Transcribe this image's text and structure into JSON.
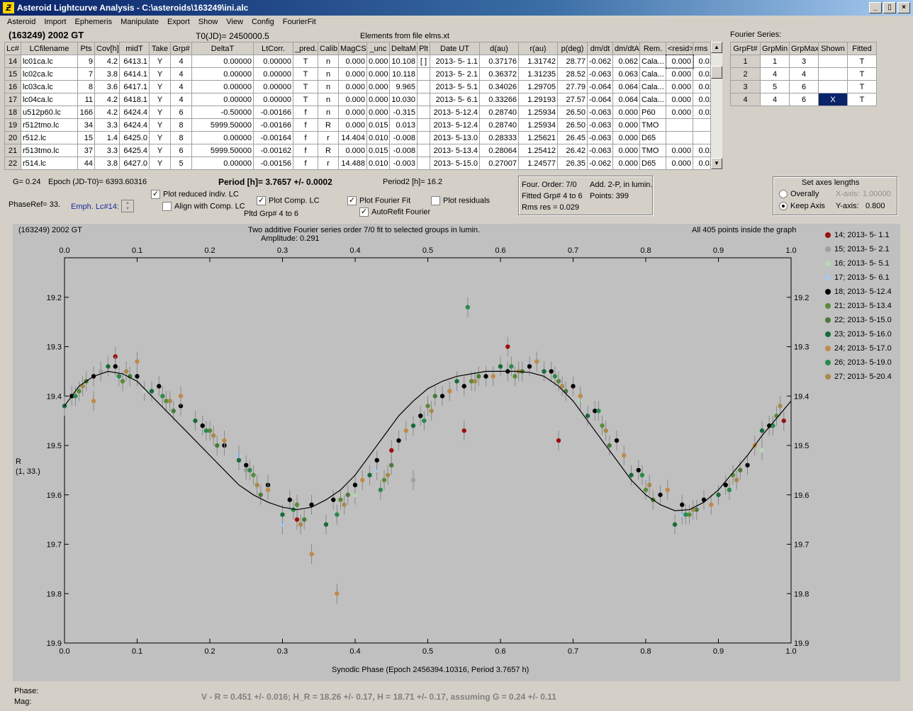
{
  "window": {
    "title": "Asteroid Lightcurve Analysis - C:\\asteroids\\163249\\ini.alc",
    "icon_letter": "Ƶ"
  },
  "window_buttons": [
    "_",
    "▯",
    "×"
  ],
  "menu": [
    "Asteroid",
    "Import",
    "Ephemeris",
    "Manipulate",
    "Export",
    "Show",
    "View",
    "Config",
    "FourierFit"
  ],
  "header": {
    "asteroid": "(163249) 2002 GT",
    "t0": "T0(JD)= 2450000.5",
    "elements": "Elements from file elms.xt",
    "fourier_label": "Fourier Series:"
  },
  "lc_table": {
    "columns": [
      "Lc#",
      "LCfilename",
      "Pts",
      "Cov[h]",
      "midT",
      "Take",
      "Grp#",
      "DeltaT",
      "LtCorr.",
      "_pred.",
      "Calib.",
      "MagCS",
      "_unc",
      "DeltaM",
      "Plt",
      "Date UT",
      "d(au)",
      "r(au)",
      "p(deg)",
      "dm/dt",
      "dm/dtA",
      "Rem.",
      "<resid>",
      "rms res"
    ],
    "rows": [
      [
        "14",
        "lc01ca.lc",
        "9",
        "4.2",
        "6413.1",
        "Y",
        "4",
        "0.00000",
        "0.00000",
        "T",
        "n",
        "0.000",
        "0.000",
        "10.108",
        "[ ]",
        "2013- 5- 1.1",
        "0.37176",
        "1.31742",
        "28.77",
        "-0.062",
        "0.062",
        "Cala...",
        "0.000",
        "0.036"
      ],
      [
        "15",
        "lc02ca.lc",
        "7",
        "3.8",
        "6414.1",
        "Y",
        "4",
        "0.00000",
        "0.00000",
        "T",
        "n",
        "0.000",
        "0.000",
        "10.118",
        "",
        "2013- 5- 2.1",
        "0.36372",
        "1.31235",
        "28.52",
        "-0.063",
        "0.063",
        "Cala...",
        "0.000",
        "0.028"
      ],
      [
        "16",
        "lc03ca.lc",
        "8",
        "3.6",
        "6417.1",
        "Y",
        "4",
        "0.00000",
        "0.00000",
        "T",
        "n",
        "0.000",
        "0.000",
        "9.965",
        "",
        "2013- 5- 5.1",
        "0.34026",
        "1.29705",
        "27.79",
        "-0.064",
        "0.064",
        "Cala...",
        "0.000",
        "0.028"
      ],
      [
        "17",
        "lc04ca.lc",
        "11",
        "4.2",
        "6418.1",
        "Y",
        "4",
        "0.00000",
        "0.00000",
        "T",
        "n",
        "0.000",
        "0.000",
        "10.030",
        "",
        "2013- 5- 6.1",
        "0.33266",
        "1.29193",
        "27.57",
        "-0.064",
        "0.064",
        "Cala...",
        "0.000",
        "0.020"
      ],
      [
        "18",
        "u512p60.lc",
        "166",
        "4.2",
        "6424.4",
        "Y",
        "6",
        "-0.50000",
        "-0.00166",
        "f",
        "n",
        "0.000",
        "0.000",
        "-0.315",
        "",
        "2013- 5-12.4",
        "0.28740",
        "1.25934",
        "26.50",
        "-0.063",
        "0.000",
        "P60",
        "0.000",
        "0.023"
      ],
      [
        "19",
        "r512tmo.lc",
        "34",
        "3.3",
        "6424.4",
        "Y",
        "8",
        "5999.50000",
        "-0.00166",
        "f",
        "R",
        "0.000",
        "0.015",
        "0.013",
        "",
        "2013- 5-12.4",
        "0.28740",
        "1.25934",
        "26.50",
        "-0.063",
        "0.000",
        "TMO",
        "",
        ""
      ],
      [
        "20",
        "r512.lc",
        "15",
        "1.4",
        "6425.0",
        "Y",
        "8",
        "0.00000",
        "-0.00164",
        "f",
        "r",
        "14.404",
        "0.010",
        "-0.008",
        "",
        "2013- 5-13.0",
        "0.28333",
        "1.25621",
        "26.45",
        "-0.063",
        "0.000",
        "D65",
        "",
        ""
      ],
      [
        "21",
        "r513tmo.lc",
        "37",
        "3.3",
        "6425.4",
        "Y",
        "6",
        "5999.50000",
        "-0.00162",
        "f",
        "R",
        "0.000",
        "0.015",
        "-0.008",
        "",
        "2013- 5-13.4",
        "0.28064",
        "1.25412",
        "26.42",
        "-0.063",
        "0.000",
        "TMO",
        "0.000",
        "0.029"
      ],
      [
        "22",
        "r514.lc",
        "44",
        "3.8",
        "6427.0",
        "Y",
        "5",
        "0.00000",
        "-0.00156",
        "f",
        "r",
        "14.488",
        "0.010",
        "-0.003",
        "",
        "2013- 5-15.0",
        "0.27007",
        "1.24577",
        "26.35",
        "-0.062",
        "0.000",
        "D65",
        "0.000",
        "0.033"
      ]
    ]
  },
  "fourier_table": {
    "columns": [
      "GrpFt#",
      "GrpMin",
      "GrpMax",
      "Shown",
      "Fitted"
    ],
    "rows": [
      [
        "1",
        "1",
        "3",
        "",
        "T"
      ],
      [
        "2",
        "4",
        "4",
        "",
        "T"
      ],
      [
        "3",
        "5",
        "6",
        "",
        "T"
      ],
      [
        "4",
        "4",
        "6",
        "X",
        "T"
      ]
    ]
  },
  "info": {
    "g": "G= 0.24",
    "epoch": "Epoch (JD-T0)= 6393.60316",
    "period": "Period [h]= 3.7657 +/- 0.0002",
    "period2": "Period2 [h]= 16.2",
    "phaseref": "PhaseRef= 33.",
    "emph": "Emph. Lc#14:",
    "four_order": "Four. Order:  7/0",
    "add": "Add. 2-P, in lumin.",
    "fitted": "Fitted Grp# 4 to 6",
    "points": "Points: 399",
    "rms": "Rms res     = 0.029"
  },
  "checkboxes": {
    "plot_reduced": {
      "label": "Plot reduced indiv. LC",
      "checked": true
    },
    "align": {
      "label": "Align with Comp. LC",
      "checked": false
    },
    "plot_comp": {
      "label": "Plot Comp. LC",
      "checked": true
    },
    "plot_fourier": {
      "label": "Plot Fourier Fit",
      "checked": true
    },
    "plot_residuals": {
      "label": "Plot residuals",
      "checked": false
    },
    "autorefit": {
      "label": "AutoRefit Fourier",
      "checked": true
    }
  },
  "pltd_grp": "Pltd Grp#  4   to    6",
  "axes_box": {
    "title": "Set axes lengths",
    "overally": "Overally",
    "keep_axis": "Keep Axis",
    "xaxis_label": "X-axis:",
    "xaxis_value": "1.00000",
    "yaxis_label": "Y-axis:",
    "yaxis_value": "0.800",
    "selected": "keep_axis"
  },
  "graph": {
    "left_title": "(163249) 2002 GT",
    "center_title": "Two additive Fourier series order 7/0 fit to selected groups in lumin.",
    "amplitude": "Amplitude: 0.291",
    "right_title": "All 405 points inside the graph",
    "ylabel1": "R",
    "ylabel2": "(1, 33.)",
    "xlabel": "Synodic Phase (Epoch 2456394.10316, Period 3.7657 h)"
  },
  "chart_data": {
    "type": "scatter",
    "x_ticks": [
      "0.0",
      "0.1",
      "0.2",
      "0.3",
      "0.4",
      "0.5",
      "0.6",
      "0.7",
      "0.8",
      "0.9",
      "1.0"
    ],
    "y_ticks": [
      "19.2",
      "19.3",
      "19.4",
      "19.5",
      "19.6",
      "19.7",
      "19.8",
      "19.9"
    ],
    "xlim": [
      0,
      1
    ],
    "ylim": [
      19.9,
      19.12
    ],
    "y_inverted": true,
    "fit_curve": {
      "x": [
        0.0,
        0.02,
        0.04,
        0.06,
        0.08,
        0.1,
        0.12,
        0.14,
        0.16,
        0.18,
        0.2,
        0.22,
        0.24,
        0.26,
        0.28,
        0.3,
        0.32,
        0.34,
        0.36,
        0.38,
        0.4,
        0.42,
        0.44,
        0.46,
        0.48,
        0.5,
        0.52,
        0.54,
        0.56,
        0.58,
        0.6,
        0.62,
        0.64,
        0.66,
        0.68,
        0.7,
        0.72,
        0.74,
        0.76,
        0.78,
        0.8,
        0.82,
        0.84,
        0.86,
        0.88,
        0.9,
        0.92,
        0.94,
        0.96,
        0.98,
        1.0
      ],
      "y": [
        19.42,
        19.38,
        19.36,
        19.35,
        19.355,
        19.37,
        19.4,
        19.43,
        19.46,
        19.49,
        19.52,
        19.55,
        19.58,
        19.6,
        19.615,
        19.625,
        19.63,
        19.625,
        19.61,
        19.59,
        19.56,
        19.52,
        19.48,
        19.44,
        19.41,
        19.385,
        19.37,
        19.36,
        19.355,
        19.35,
        19.35,
        19.35,
        19.352,
        19.36,
        19.38,
        19.41,
        19.45,
        19.49,
        19.53,
        19.57,
        19.6,
        19.62,
        19.632,
        19.63,
        19.615,
        19.59,
        19.555,
        19.52,
        19.48,
        19.445,
        19.41
      ]
    },
    "series": [
      {
        "name": "14; 2013- 5- 1.1",
        "color": "#9b1010",
        "x": [
          0.07,
          0.32,
          0.55,
          0.68,
          0.61,
          0.45,
          0.99
        ],
        "y": [
          19.32,
          19.65,
          19.47,
          19.49,
          19.3,
          19.51,
          19.45
        ]
      },
      {
        "name": "15; 2013- 5- 2.1",
        "color": "#a0a0a0",
        "x": [
          0.05,
          0.25,
          0.48
        ],
        "y": [
          19.35,
          19.55,
          19.57
        ]
      },
      {
        "name": "16; 2013- 5- 5.1",
        "color": "#b8d8b8",
        "x": [
          0.11,
          0.4,
          0.71,
          0.96
        ],
        "y": [
          19.39,
          19.6,
          19.41,
          19.51
        ]
      },
      {
        "name": "17; 2013- 5- 6.1",
        "color": "#a8c8e8",
        "x": [
          0.24,
          0.3,
          0.43,
          0.85
        ],
        "y": [
          19.52,
          19.66,
          19.55,
          19.64
        ]
      },
      {
        "name": "18; 2013- 5-12.4",
        "color": "#000000",
        "x": [
          0.01,
          0.04,
          0.07,
          0.1,
          0.13,
          0.16,
          0.19,
          0.22,
          0.25,
          0.28,
          0.31,
          0.34,
          0.37,
          0.4,
          0.43,
          0.46,
          0.49,
          0.52,
          0.55,
          0.58,
          0.61,
          0.64,
          0.67,
          0.7,
          0.73,
          0.76,
          0.79,
          0.82,
          0.85,
          0.88,
          0.91,
          0.94,
          0.97
        ],
        "y": [
          19.4,
          19.36,
          19.34,
          19.36,
          19.38,
          19.42,
          19.46,
          19.5,
          19.54,
          19.58,
          19.61,
          19.62,
          19.61,
          19.58,
          19.53,
          19.49,
          19.44,
          19.4,
          19.38,
          19.36,
          19.35,
          19.34,
          19.35,
          19.38,
          19.43,
          19.49,
          19.55,
          19.6,
          19.62,
          19.61,
          19.58,
          19.54,
          19.46
        ]
      },
      {
        "name": "21; 2013- 5-13.4",
        "color": "#5a8a3a",
        "x": [
          0.02,
          0.08,
          0.14,
          0.2,
          0.26,
          0.32,
          0.38,
          0.44,
          0.5,
          0.56,
          0.62,
          0.68,
          0.74,
          0.8,
          0.86,
          0.92,
          0.98
        ],
        "y": [
          19.39,
          19.37,
          19.41,
          19.47,
          19.56,
          19.62,
          19.61,
          19.57,
          19.42,
          19.37,
          19.36,
          19.37,
          19.46,
          19.59,
          19.64,
          19.56,
          19.44
        ]
      },
      {
        "name": "22; 2013- 5-15.0",
        "color": "#4a7a3a",
        "x": [
          0.03,
          0.09,
          0.15,
          0.21,
          0.27,
          0.33,
          0.39,
          0.45,
          0.51,
          0.57,
          0.63,
          0.69,
          0.75,
          0.81,
          0.87,
          0.93
        ],
        "y": [
          19.37,
          19.36,
          19.43,
          19.5,
          19.6,
          19.65,
          19.6,
          19.54,
          19.4,
          19.36,
          19.35,
          19.39,
          19.5,
          19.61,
          19.63,
          19.55
        ]
      },
      {
        "name": "23; 2013- 5-16.0",
        "color": "#1a6a3a",
        "x": [
          0.0,
          0.06,
          0.12,
          0.18,
          0.24,
          0.3,
          0.36,
          0.42,
          0.48,
          0.54,
          0.6,
          0.66,
          0.72,
          0.78,
          0.84,
          0.9,
          0.96
        ],
        "y": [
          19.42,
          19.34,
          19.39,
          19.45,
          19.53,
          19.64,
          19.66,
          19.56,
          19.46,
          19.37,
          19.34,
          19.35,
          19.44,
          19.56,
          19.66,
          19.6,
          19.47
        ]
      },
      {
        "name": "24; 2013- 5-17.0",
        "color": "#c08a4a",
        "x": [
          0.04,
          0.1,
          0.16,
          0.22,
          0.28,
          0.34,
          0.375,
          0.41,
          0.47,
          0.53,
          0.59,
          0.65,
          0.71,
          0.77,
          0.83,
          0.89,
          0.95
        ],
        "y": [
          19.41,
          19.33,
          19.4,
          19.49,
          19.59,
          19.72,
          19.8,
          19.57,
          19.47,
          19.39,
          19.36,
          19.33,
          19.4,
          19.52,
          19.59,
          19.62,
          19.5
        ]
      },
      {
        "name": "26; 2013- 5-19.0",
        "color": "#2a8a4a",
        "x": [
          0.015,
          0.075,
          0.135,
          0.195,
          0.255,
          0.315,
          0.375,
          0.435,
          0.495,
          0.555,
          0.615,
          0.675,
          0.735,
          0.795,
          0.855,
          0.915,
          0.975
        ],
        "y": [
          19.4,
          19.36,
          19.4,
          19.47,
          19.55,
          19.63,
          19.64,
          19.59,
          19.45,
          19.22,
          19.34,
          19.36,
          19.43,
          19.56,
          19.64,
          19.59,
          19.46
        ]
      },
      {
        "name": "27; 2013- 5-20.4",
        "color": "#a88a4a",
        "x": [
          0.025,
          0.085,
          0.145,
          0.205,
          0.265,
          0.325,
          0.385,
          0.445,
          0.505,
          0.565,
          0.625,
          0.685,
          0.745,
          0.805,
          0.865,
          0.925,
          0.985
        ],
        "y": [
          19.38,
          19.35,
          19.41,
          19.48,
          19.58,
          19.66,
          19.62,
          19.56,
          19.43,
          19.37,
          19.35,
          19.38,
          19.47,
          19.58,
          19.63,
          19.57,
          19.42
        ]
      }
    ]
  },
  "bottom": {
    "phase_label": "Phase:",
    "mag_label": "Mag:",
    "summary": "V - R = 0.451 +/- 0.016; H_R = 18.26 +/- 0.17, H = 18.71 +/- 0.17, assuming G = 0.24 +/- 0.11"
  }
}
